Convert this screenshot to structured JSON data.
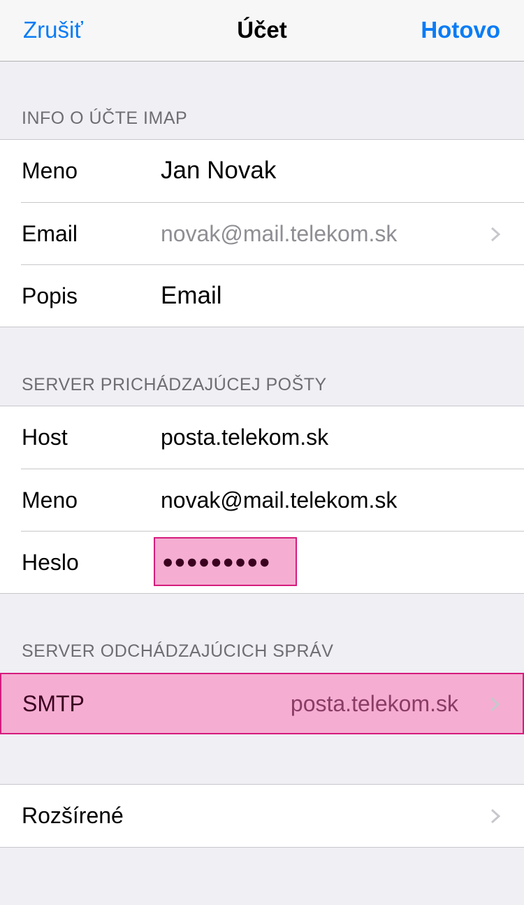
{
  "nav": {
    "cancel": "Zrušiť",
    "title": "Účet",
    "done": "Hotovo"
  },
  "imap_section": {
    "header": "INFO O ÚČTE IMAP",
    "rows": [
      {
        "label": "Meno",
        "value": "Jan Novak"
      },
      {
        "label": "Email",
        "value": "novak@mail.telekom.sk"
      },
      {
        "label": "Popis",
        "value": "Email"
      }
    ]
  },
  "incoming_section": {
    "header": "SERVER PRICHÁDZAJÚCEJ POŠTY",
    "rows": [
      {
        "label": "Host",
        "value": "posta.telekom.sk"
      },
      {
        "label": "Meno",
        "value": "novak@mail.telekom.sk"
      },
      {
        "label": "Heslo",
        "value": "●●●●●●●●●"
      }
    ]
  },
  "outgoing_section": {
    "header": "SERVER ODCHÁDZAJÚCICH SPRÁV",
    "smtp_label": "SMTP",
    "smtp_value": "posta.telekom.sk"
  },
  "advanced": {
    "label": "Rozšírené"
  },
  "colors": {
    "accent": "#0a7cf5",
    "highlight_fill": "#f5aed2",
    "highlight_border": "#d51c7d"
  },
  "icons": {
    "disclosure": "chevron-right-icon"
  }
}
